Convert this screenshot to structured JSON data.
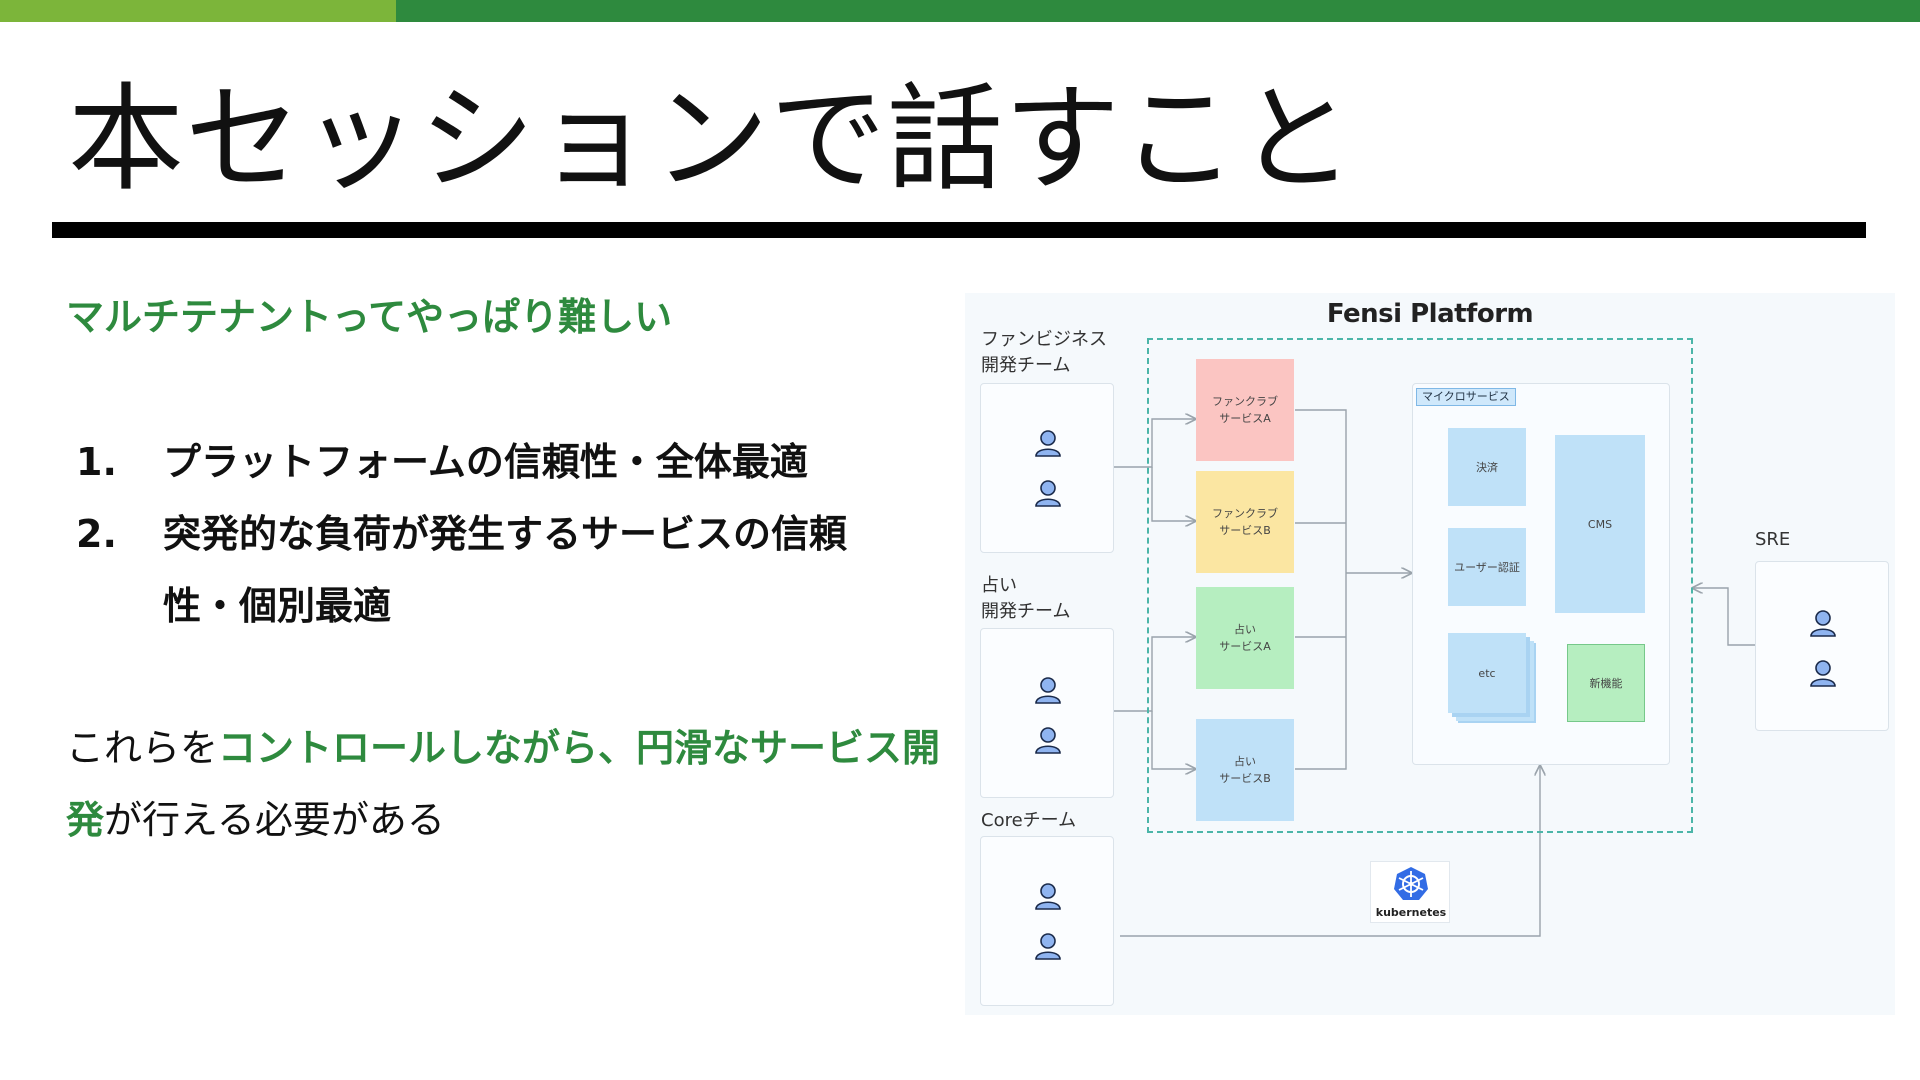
{
  "slide": {
    "title": "本セッションで話すこと",
    "subtitle": "マルチテナントってやっぱり難しい",
    "list": [
      {
        "num": "1.",
        "text": "プラットフォームの信頼性・全体最適"
      },
      {
        "num": "2.",
        "text": "突発的な負荷が発生するサービスの信頼性・個別最適"
      }
    ],
    "conclusion": {
      "pre": "これらを",
      "highlight": "コントロールしながら、円滑なサービス開発",
      "post": "が行える必要がある"
    }
  },
  "diagram": {
    "platform_title": "Fensi Platform",
    "teams": [
      {
        "label_line1": "ファンビジネス",
        "label_line2": "開発チーム"
      },
      {
        "label_line1": "占い",
        "label_line2": "開発チーム"
      },
      {
        "label_line1": "Coreチーム",
        "label_line2": ""
      }
    ],
    "services": [
      {
        "label": "ファンクラブ\nサービスA"
      },
      {
        "label": "ファンクラブ\nサービスB"
      },
      {
        "label": "占い\nサービスA"
      },
      {
        "label": "占い\nサービスB"
      }
    ],
    "microservices": {
      "tag": "マイクロサービス",
      "items": [
        "決済",
        "ユーザー認証",
        "etc",
        "CMS",
        "新機能"
      ]
    },
    "sre_label": "SRE",
    "k8s_label": "kubernetes",
    "colors": {
      "green_accent": "#2e8a3e",
      "light_green": "#7cb53a",
      "svc_red": "#fbc5c2",
      "svc_yellow": "#fbe6a2",
      "svc_green": "#b6eec0",
      "svc_blue": "#bfe1f8",
      "k8s_blue": "#326ce5"
    }
  }
}
